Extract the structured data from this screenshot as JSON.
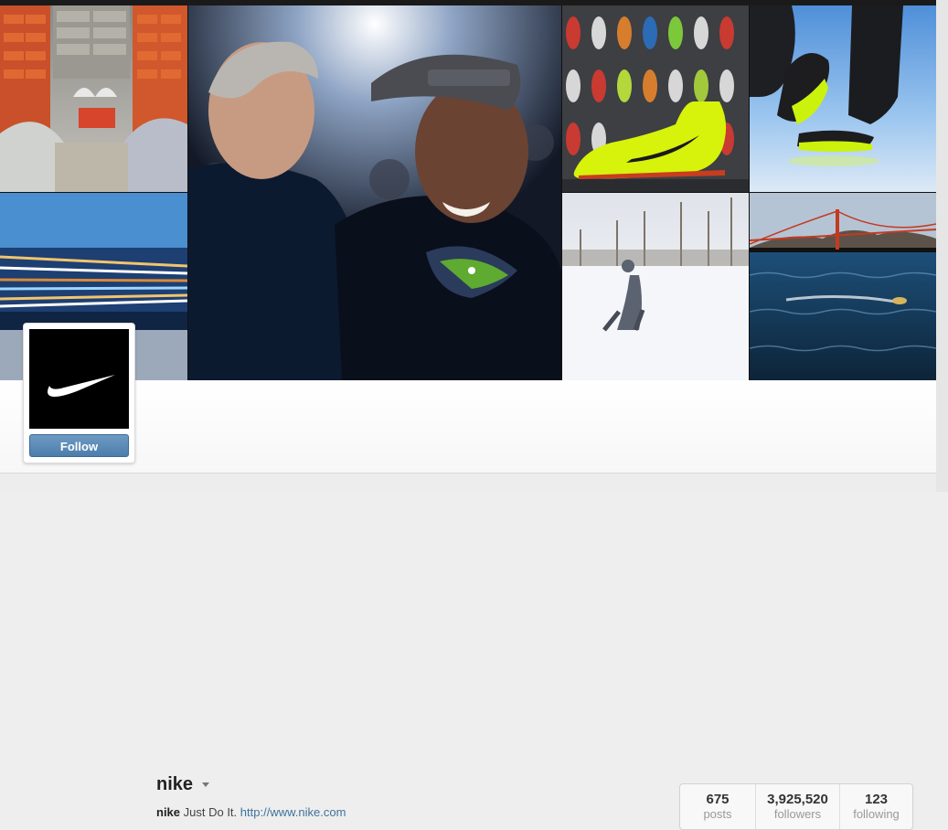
{
  "profile": {
    "username": "nike",
    "bio_handle": "nike",
    "bio_text": "Just Do It.",
    "website": "http://www.nike.com",
    "follow_label": "Follow",
    "menu_icon": "chevron-down-icon",
    "avatar_icon": "nike-swoosh-logo"
  },
  "stats": [
    {
      "value": "675",
      "label": "posts"
    },
    {
      "value": "3,925,520",
      "label": "followers"
    },
    {
      "value": "123",
      "label": "following"
    }
  ],
  "colors": {
    "follow_button": "#5a8ab7",
    "link": "#3f729b",
    "seahawks_green": "#69be28",
    "volt": "#d7f20b"
  }
}
